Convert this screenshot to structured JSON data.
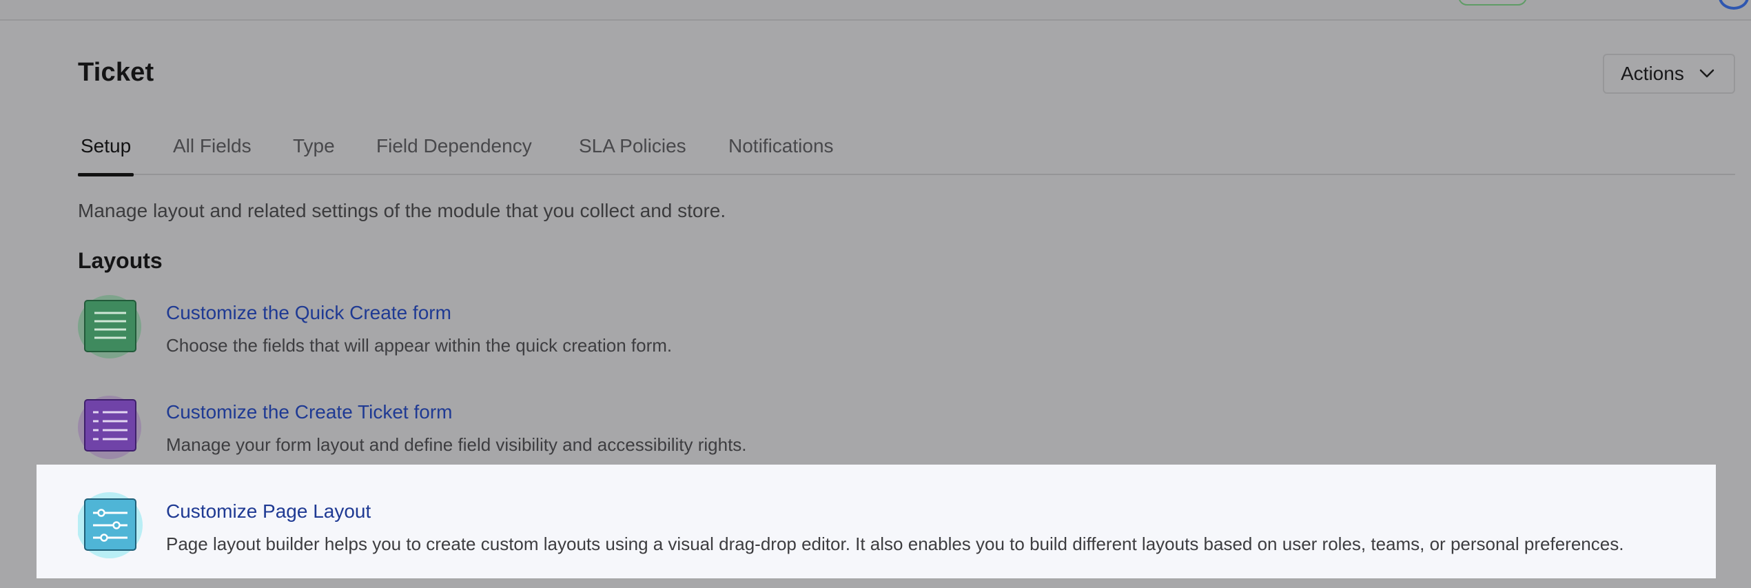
{
  "header": {
    "title": "Ticket"
  },
  "actions": {
    "label": "Actions"
  },
  "tabs": [
    {
      "label": "Setup"
    },
    {
      "label": "All Fields"
    },
    {
      "label": "Type"
    },
    {
      "label": "Field Dependency"
    },
    {
      "label": "SLA Policies"
    },
    {
      "label": "Notifications"
    }
  ],
  "description": "Manage layout and related settings of the module that you collect and store.",
  "layouts": {
    "heading": "Layouts",
    "items": [
      {
        "title": "Customize the Quick Create form",
        "subtitle": "Choose the fields that will appear within the quick creation form.",
        "icon": "list-form-icon",
        "color": "#3d8a5f"
      },
      {
        "title": "Customize the Create Ticket form",
        "subtitle": "Manage your form layout and define field visibility and accessibility rights.",
        "icon": "bulleted-list-icon",
        "color": "#6f3fa8"
      },
      {
        "title": "Customize Page Layout",
        "subtitle": "Page layout builder helps you to create custom layouts using a visual drag-drop editor. It also enables you to build different layouts based on user roles, teams, or personal preferences.",
        "icon": "sliders-icon",
        "color": "#4db8d8"
      }
    ]
  },
  "colors": {
    "overlay_bg": "#a7a7a9",
    "highlight_bg": "#f6f7fb",
    "link": "#1f3a93"
  }
}
